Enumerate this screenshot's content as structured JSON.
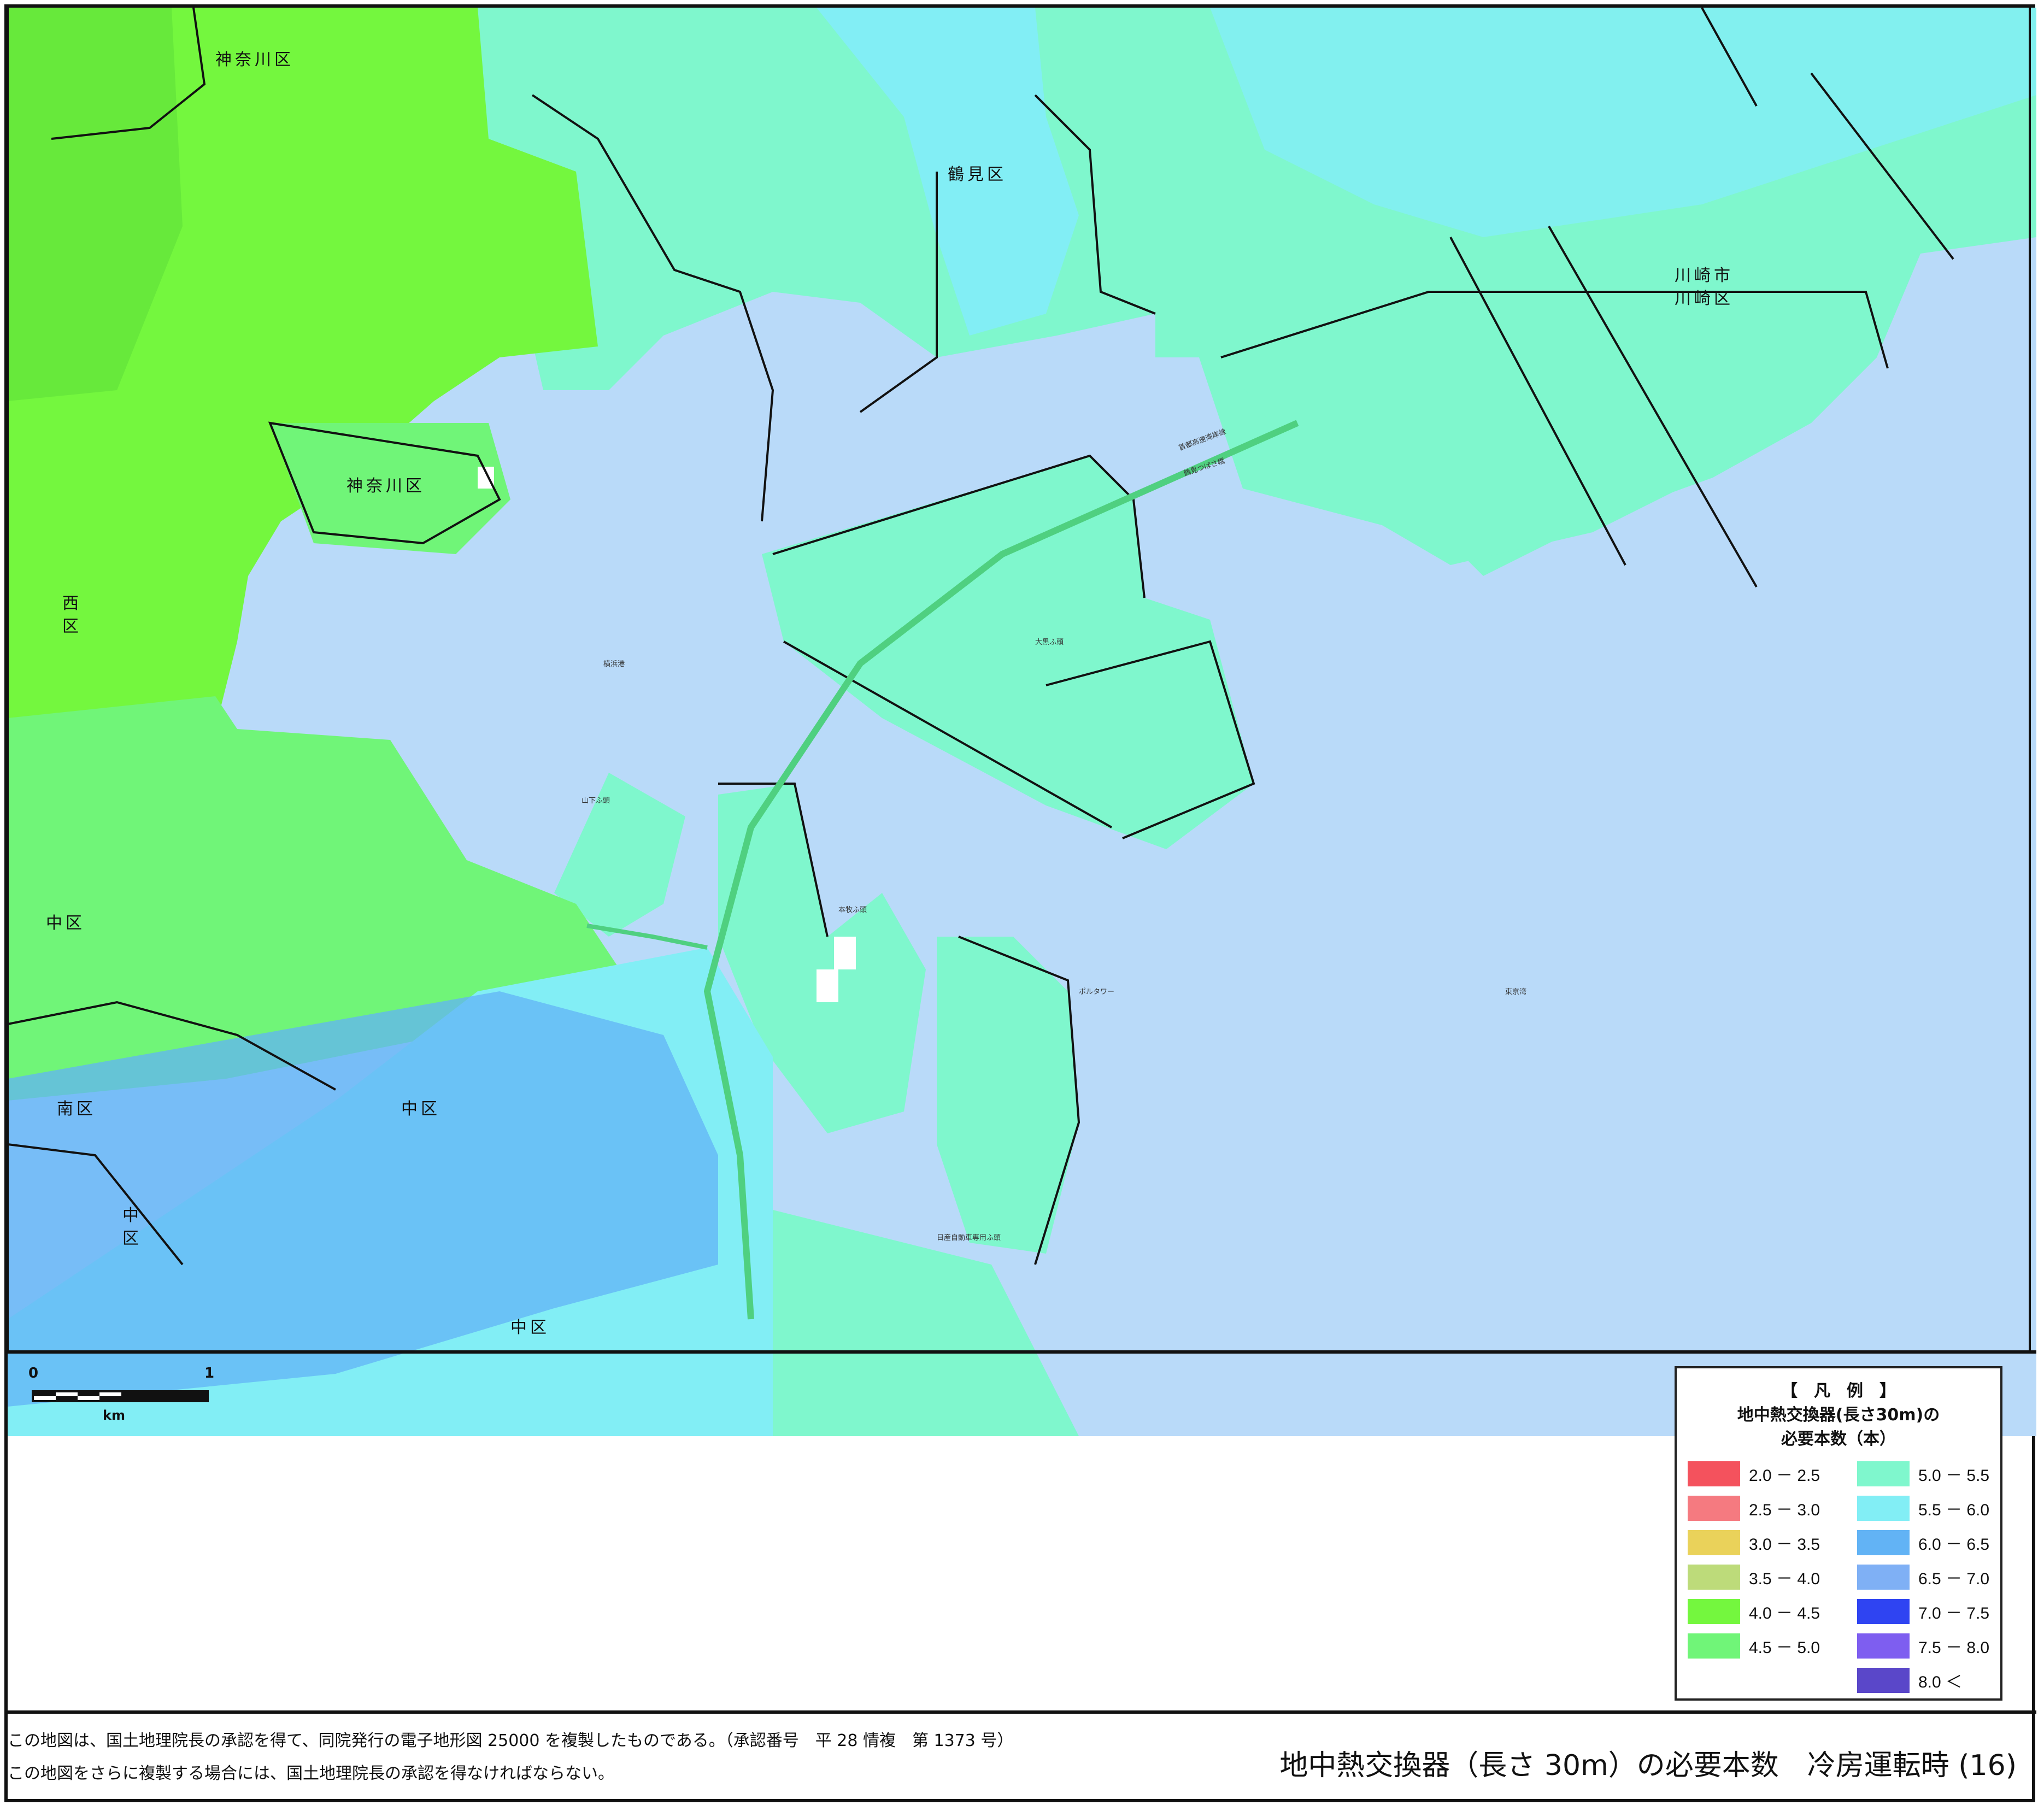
{
  "map": {
    "place_labels": {
      "kanagawa_top": "神奈川区",
      "kanagawa_mid": "神奈川区",
      "nishi": "西\n区",
      "naka_left": "中区",
      "minami": "南区",
      "naka_center": "中区",
      "naka_vertical": "中\n区",
      "naka_bottom": "中区",
      "tsurumi": "鶴見区",
      "kawasaki": "川崎市\n川崎区",
      "tokyo_bay": "東京湾",
      "yokohama_port": "横浜港",
      "bay_bridge": "首都高速湾岸線",
      "yokohama_bay_tower": "ポルタワー",
      "yamashita_pier": "山下ふ頭",
      "honmoku_pier": "本牧ふ頭",
      "daikoku": "大黒ふ頭",
      "tsubasa_bridge": "鶴見つばさ橋",
      "car_pier": "日産自動車専用ふ頭"
    },
    "scale": {
      "zero": "0",
      "one": "1",
      "unit": "km"
    }
  },
  "legend": {
    "title": "【　凡　例　】",
    "subtitle_1": "地中熱交換器(長さ30m)の",
    "subtitle_2": "必要本数（本）",
    "items": [
      {
        "range": "2.0 － 2.5",
        "color": "#f4525d"
      },
      {
        "range": "2.5 － 3.0",
        "color": "#f57a80"
      },
      {
        "range": "3.0 － 3.5",
        "color": "#ead25a"
      },
      {
        "range": "3.5 － 4.0",
        "color": "#bddb7a"
      },
      {
        "range": "4.0 － 4.5",
        "color": "#74f73e"
      },
      {
        "range": "4.5 － 5.0",
        "color": "#70f578"
      },
      {
        "range": "5.0 － 5.5",
        "color": "#7ff7cd"
      },
      {
        "range": "5.5 － 6.0",
        "color": "#82eef5"
      },
      {
        "range": "6.0 － 6.5",
        "color": "#62b3f5"
      },
      {
        "range": "6.5 － 7.0",
        "color": "#7fb0f5"
      },
      {
        "range": "7.0 － 7.5",
        "color": "#2f44f2"
      },
      {
        "range": "7.5 － 8.0",
        "color": "#7e5ef0"
      },
      {
        "range": "8.0 ＜",
        "color": "#5a47c9"
      }
    ]
  },
  "footer": {
    "note_1": "この地図は、国土地理院長の承認を得て、同院発行の電子地形図 25000 を複製したものである。（承認番号　平 28 情複　第 1373 号）",
    "note_2": "この地図をさらに複製する場合には、国土地理院長の承認を得なければならない。",
    "title": "地中熱交換器（長さ 30m）の必要本数　冷房運転時 (16)"
  },
  "colors": {
    "sea": "#b9daf9",
    "green_land": "#74f73e",
    "light_green": "#70f578",
    "aqua": "#7ff7cd",
    "cyan": "#82eef5",
    "blue": "#62b3f5",
    "boundary": "#111111"
  }
}
